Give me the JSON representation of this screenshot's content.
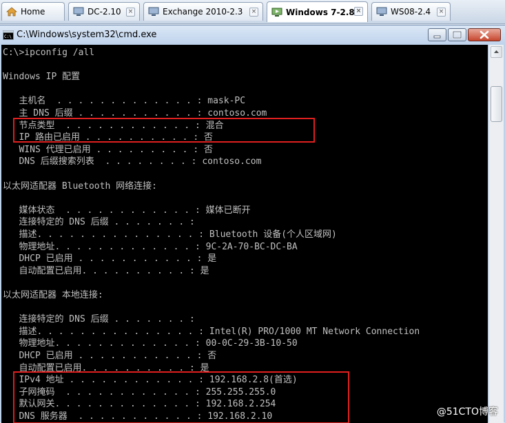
{
  "tabs": [
    {
      "label": "Home",
      "icon": "home-icon",
      "active": false,
      "closable": false
    },
    {
      "label": "DC-2.10",
      "icon": "vm-icon",
      "active": false,
      "closable": true
    },
    {
      "label": "Exchange 2010-2.3",
      "icon": "vm-icon",
      "active": false,
      "closable": true
    },
    {
      "label": "Windows 7-2.8",
      "icon": "vm-running-icon",
      "active": true,
      "closable": true
    },
    {
      "label": "WS08-2.4",
      "icon": "vm-icon",
      "active": false,
      "closable": true
    }
  ],
  "window": {
    "title": "C:\\Windows\\system32\\cmd.exe",
    "icon": "cmd-icon"
  },
  "console": {
    "lines": [
      "C:\\>ipconfig /all",
      "",
      "Windows IP 配置",
      "",
      "   主机名  . . . . . . . . . . . . . : mask-PC",
      "   主 DNS 后缀 . . . . . . . . . . . : contoso.com",
      "   节点类型  . . . . . . . . . . . . : 混合",
      "   IP 路由已启用 . . . . . . . . . . : 否",
      "   WINS 代理已启用 . . . . . . . . . : 否",
      "   DNS 后缀搜索列表  . . . . . . . . : contoso.com",
      "",
      "以太网适配器 Bluetooth 网络连接:",
      "",
      "   媒体状态  . . . . . . . . . . . . : 媒体已断开",
      "   连接特定的 DNS 后缀 . . . . . . . :",
      "   描述. . . . . . . . . . . . . . . : Bluetooth 设备(个人区域网)",
      "   物理地址. . . . . . . . . . . . . : 9C-2A-70-BC-DC-BA",
      "   DHCP 已启用 . . . . . . . . . . . : 是",
      "   自动配置已启用. . . . . . . . . . : 是",
      "",
      "以太网适配器 本地连接:",
      "",
      "   连接特定的 DNS 后缀 . . . . . . . :",
      "   描述. . . . . . . . . . . . . . . : Intel(R) PRO/1000 MT Network Connection",
      "   物理地址. . . . . . . . . . . . . : 00-0C-29-3B-10-50",
      "   DHCP 已启用 . . . . . . . . . . . : 否",
      "   自动配置已启用. . . . . . . . . . : 是",
      "   IPv4 地址 . . . . . . . . . . . . : 192.168.2.8(首选)",
      "   子网掩码  . . . . . . . . . . . . : 255.255.255.0",
      "   默认网关. . . . . . . . . . . . . : 192.168.2.254",
      "   DNS 服务器  . . . . . . . . . . . : 192.168.2.10"
    ],
    "text_color": "#c0c0c0",
    "background": "#000000",
    "highlight_color": "#e0201e"
  },
  "watermark": "@51CTO博客"
}
